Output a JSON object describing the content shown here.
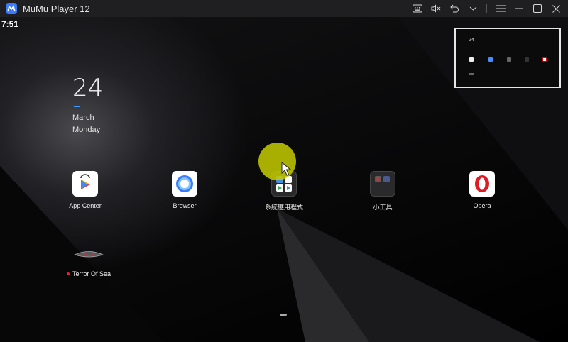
{
  "window": {
    "title": "MuMu Player 12"
  },
  "status": {
    "time": "7:51"
  },
  "clock": {
    "day": "24",
    "month": "March",
    "weekday": "Monday"
  },
  "preview": {
    "day": "24"
  },
  "apps": [
    {
      "label": "App Center",
      "icon": "play-store-icon"
    },
    {
      "label": "Browser",
      "icon": "browser-icon"
    },
    {
      "label": "系統應用程式",
      "icon": "system-apps-folder-icon"
    },
    {
      "label": "小工具",
      "icon": "tools-folder-icon"
    },
    {
      "label": "Opera",
      "icon": "opera-icon"
    }
  ],
  "game": {
    "label": "Terror Of Sea",
    "icon": "terror-of-sea-icon"
  },
  "colors": {
    "accent": "#3b9cff",
    "cursor_highlight": "#c4cd00",
    "notification_dot": "#e0263b",
    "titlebar": "#1f1f21"
  }
}
